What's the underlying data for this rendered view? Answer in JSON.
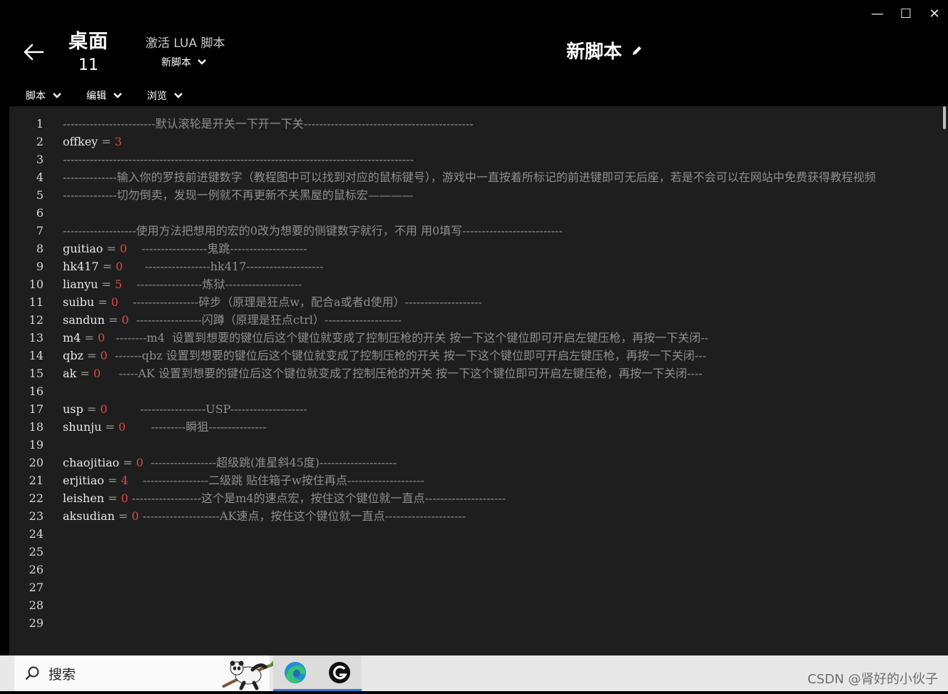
{
  "window": {
    "minimize": "—",
    "maximize": "☐",
    "close": "✕"
  },
  "header": {
    "profile_name": "桌面",
    "profile_number": "11",
    "lua_label": "激活 LUA 脚本",
    "script_select": "新脚本",
    "script_title": "新脚本"
  },
  "menus": [
    {
      "label": "脚本"
    },
    {
      "label": "编辑"
    },
    {
      "label": "浏览"
    }
  ],
  "editor": {
    "lines": [
      {
        "n": "1",
        "var": "",
        "val": "",
        "comment": "------------------------默认滚轮是开关一下开一下关--------------------------------------------"
      },
      {
        "n": "2",
        "var": "offkey",
        "val": "3",
        "comment": ""
      },
      {
        "n": "3",
        "var": "",
        "val": "",
        "comment": "-------------------------------------------------------------------------------------------"
      },
      {
        "n": "4",
        "var": "",
        "val": "",
        "comment": "--------------输入你的罗技前进键数字（教程图中可以找到对应的鼠标键号），游戏中一直按着所标记的前进键即可无后座，若是不会可以在网站中免费获得教程视频"
      },
      {
        "n": "5",
        "var": "",
        "val": "",
        "comment": "--------------切勿倒卖，发现一例就不再更新不关黑屋的鼠标宏————"
      },
      {
        "n": "6",
        "var": "",
        "val": "",
        "comment": ""
      },
      {
        "n": "7",
        "var": "",
        "val": "",
        "comment": "-------------------使用方法把想用的宏的0改为想要的侧键数字就行，不用 用0填写--------------------------"
      },
      {
        "n": "8",
        "var": "guitiao",
        "val": "0",
        "pad": "    ",
        "comment": "-----------------鬼跳--------------------"
      },
      {
        "n": "9",
        "var": "hk417",
        "val": "0",
        "pad": "      ",
        "comment": "-----------------hk417--------------------"
      },
      {
        "n": "10",
        "var": "lianyu",
        "val": "5",
        "pad": "    ",
        "comment": "-----------------炼狱--------------------"
      },
      {
        "n": "11",
        "var": "suibu",
        "val": "0",
        "pad": "    ",
        "comment": "-----------------碎步（原理是狂点w，配合a或者d使用）--------------------"
      },
      {
        "n": "12",
        "var": "sandun",
        "val": "0",
        "pad": "  ",
        "comment": "-----------------闪蹲（原理是狂点ctrl）--------------------"
      },
      {
        "n": "13",
        "var": "m4",
        "val": "0",
        "pad": "   ",
        "comment": "--------m4  设置到想要的键位后这个键位就变成了控制压枪的开关 按一下这个键位即可开启左键压枪，再按一下关闭--"
      },
      {
        "n": "14",
        "var": "qbz",
        "val": "0",
        "pad": "  ",
        "comment": "-------qbz 设置到想要的键位后这个键位就变成了控制压枪的开关 按一下这个键位即可开启左键压枪，再按一下关闭---"
      },
      {
        "n": "15",
        "var": "ak",
        "val": "0",
        "pad": "     ",
        "comment": "-----AK 设置到想要的键位后这个键位就变成了控制压枪的开关 按一下这个键位即可开启左键压枪，再按一下关闭----"
      },
      {
        "n": "16",
        "var": "",
        "val": "",
        "comment": ""
      },
      {
        "n": "17",
        "var": "usp",
        "val": "0",
        "pad": "         ",
        "comment": "-----------------USP--------------------"
      },
      {
        "n": "18",
        "var": "shunju",
        "val": "0",
        "pad": "       ",
        "comment": "---------瞬狙---------------"
      },
      {
        "n": "19",
        "var": "",
        "val": "",
        "comment": ""
      },
      {
        "n": "20",
        "var": "chaojitiao",
        "val": "0",
        "pad": "  ",
        "comment": "-----------------超级跳(准星斜45度)--------------------"
      },
      {
        "n": "21",
        "var": "erjitiao",
        "val": "4",
        "pad": "    ",
        "comment": "-----------------二级跳 贴住箱子w按住再点--------------------"
      },
      {
        "n": "22",
        "var": "leishen",
        "val": "0",
        "pad": " ",
        "comment": "------------------这个是m4的速点宏，按住这个键位就一直点---------------------"
      },
      {
        "n": "23",
        "var": "aksudian",
        "val": "0",
        "pad": " ",
        "comment": "--------------------AK速点，按住这个键位就一直点---------------------"
      },
      {
        "n": "24",
        "var": "",
        "val": "",
        "comment": ""
      },
      {
        "n": "25",
        "var": "",
        "val": "",
        "comment": ""
      },
      {
        "n": "26",
        "var": "",
        "val": "",
        "comment": ""
      },
      {
        "n": "27",
        "var": "",
        "val": "",
        "comment": ""
      },
      {
        "n": "28",
        "var": "",
        "val": "",
        "comment": ""
      },
      {
        "n": "29",
        "var": "",
        "val": "",
        "comment": ""
      }
    ]
  },
  "taskbar": {
    "search_label": "搜索"
  },
  "watermark": "CSDN @肾好的小伙子",
  "colors": {
    "background": "#000000",
    "editor_bg": "#1e1e1e",
    "number": "#e04646",
    "comment": "#8f8f8f",
    "taskbar": "#e8e8e8",
    "accent": "#2c7ad6"
  }
}
